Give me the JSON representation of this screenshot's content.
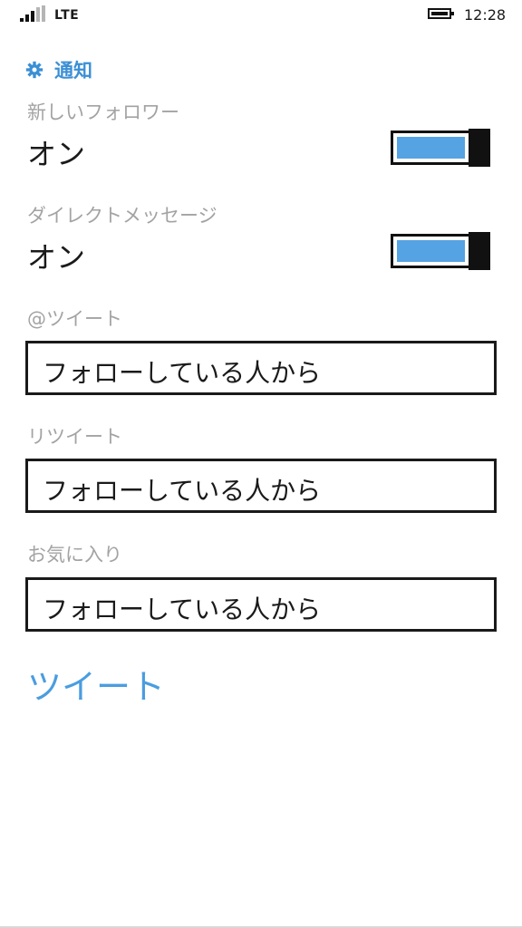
{
  "status_bar": {
    "network": "LTE",
    "time": "12:28"
  },
  "header": {
    "title": "通知",
    "icon": "gear-icon",
    "accent_color": "#3b8fd5"
  },
  "settings": {
    "new_followers": {
      "label": "新しいフォロワー",
      "value": "オン",
      "toggle_on": true
    },
    "direct_messages": {
      "label": "ダイレクトメッセージ",
      "value": "オン",
      "toggle_on": true
    },
    "mentions": {
      "label": "@ツイート",
      "selected": "フォローしている人から"
    },
    "retweets": {
      "label": "リツイート",
      "selected": "フォローしている人から"
    },
    "favorites": {
      "label": "お気に入り",
      "selected": "フォローしている人から"
    }
  },
  "tweet_link": {
    "label": "ツイート",
    "color": "#4a9de0"
  },
  "colors": {
    "toggle_fill": "#55a3e2",
    "label_gray": "#a3a3a3"
  }
}
